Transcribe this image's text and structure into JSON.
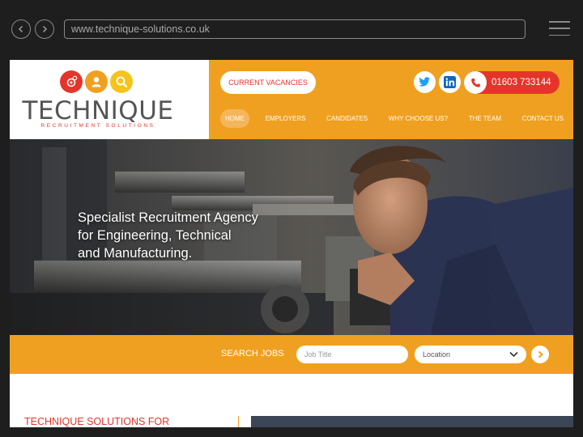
{
  "browser": {
    "url": "www.technique-solutions.co.uk"
  },
  "brand": {
    "name": "TECHNIQUE",
    "tagline_sub": "RECRUITMENT SOLUTIONS",
    "colors": {
      "orange": "#f0a020",
      "red": "#e5352b",
      "yellow": "#f5c31c",
      "grey": "#555555"
    }
  },
  "header": {
    "vacancies_label": "CURRENT VACANCIES",
    "phone": "01603 733144",
    "social_icons": [
      "twitter-icon",
      "linkedin-icon"
    ]
  },
  "nav": {
    "items": [
      {
        "label": "HOME",
        "active": true
      },
      {
        "label": "EMPLOYERS",
        "active": false
      },
      {
        "label": "CANDIDATES",
        "active": false
      },
      {
        "label": "WHY CHOOSE US?",
        "active": false
      },
      {
        "label": "THE TEAM",
        "active": false
      },
      {
        "label": "CONTACT US",
        "active": false
      }
    ]
  },
  "hero": {
    "line1": "Specialist Recruitment Agency",
    "line2": "for Engineering, Technical",
    "line3": "and Manufacturing."
  },
  "search": {
    "label": "SEARCH JOBS",
    "job_placeholder": "Job Title",
    "location_value": "Location"
  },
  "intro": {
    "heading": "TECHNIQUE SOLUTIONS FOR"
  }
}
